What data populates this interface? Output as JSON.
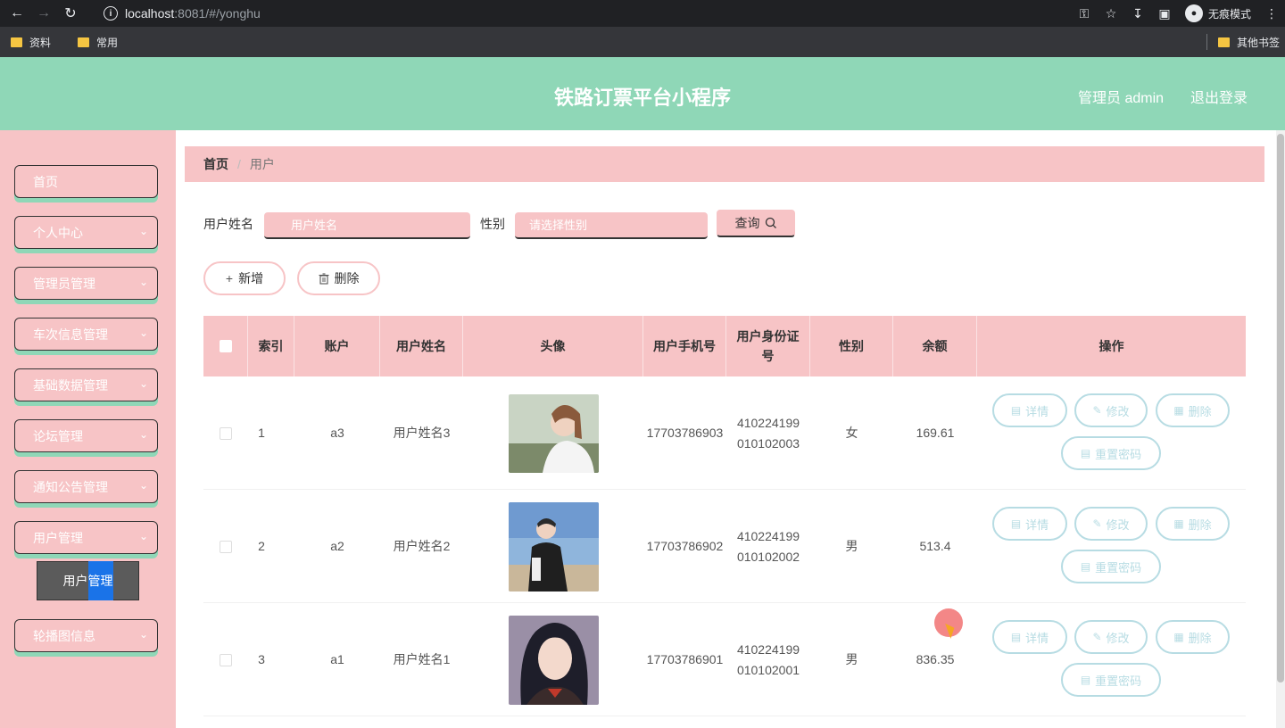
{
  "browser": {
    "url_host": "localhost",
    "url_rest": ":8081/#/yonghu",
    "incognito_label": "无痕模式",
    "bookmarks": [
      "资料",
      "常用"
    ],
    "other_bookmarks": "其他书签"
  },
  "header": {
    "title": "铁路订票平台小程序",
    "user": "管理员 admin",
    "logout": "退出登录"
  },
  "sidebar": {
    "items": [
      {
        "label": "首页"
      },
      {
        "label": "个人中心"
      },
      {
        "label": "管理员管理"
      },
      {
        "label": "车次信息管理"
      },
      {
        "label": "基础数据管理"
      },
      {
        "label": "论坛管理"
      },
      {
        "label": "通知公告管理"
      },
      {
        "label": "用户管理"
      },
      {
        "label": "轮播图信息"
      }
    ],
    "submenu": {
      "part1": "用户",
      "part2": "管理"
    }
  },
  "breadcrumb": {
    "home": "首页",
    "current": "用户"
  },
  "search": {
    "name_label": "用户姓名",
    "name_placeholder": "用户姓名",
    "gender_label": "性别",
    "gender_placeholder": "请选择性别",
    "query_label": "查询"
  },
  "toolbar": {
    "add_label": "新增",
    "delete_label": "删除"
  },
  "table": {
    "headers": {
      "index": "索引",
      "account": "账户",
      "name": "用户姓名",
      "avatar": "头像",
      "phone": "用户手机号",
      "id_card": "用户身份证号",
      "gender": "性别",
      "balance": "余额",
      "actions": "操作"
    },
    "actions": {
      "detail": "详情",
      "edit": "修改",
      "delete": "删除",
      "reset": "重置密码"
    },
    "rows": [
      {
        "index": "1",
        "account": "a3",
        "name": "用户姓名3",
        "phone": "17703786903",
        "id_card": "410224199010102003",
        "gender": "女",
        "balance": "169.61"
      },
      {
        "index": "2",
        "account": "a2",
        "name": "用户姓名2",
        "phone": "17703786902",
        "id_card": "410224199010102002",
        "gender": "男",
        "balance": "513.4"
      },
      {
        "index": "3",
        "account": "a1",
        "name": "用户姓名1",
        "phone": "17703786901",
        "id_card": "410224199010102001",
        "gender": "男",
        "balance": "836.35"
      }
    ]
  },
  "colors": {
    "header_green": "#8fd7b7",
    "accent_pink": "#f7c4c6",
    "action_blue": "#b7dce3"
  }
}
